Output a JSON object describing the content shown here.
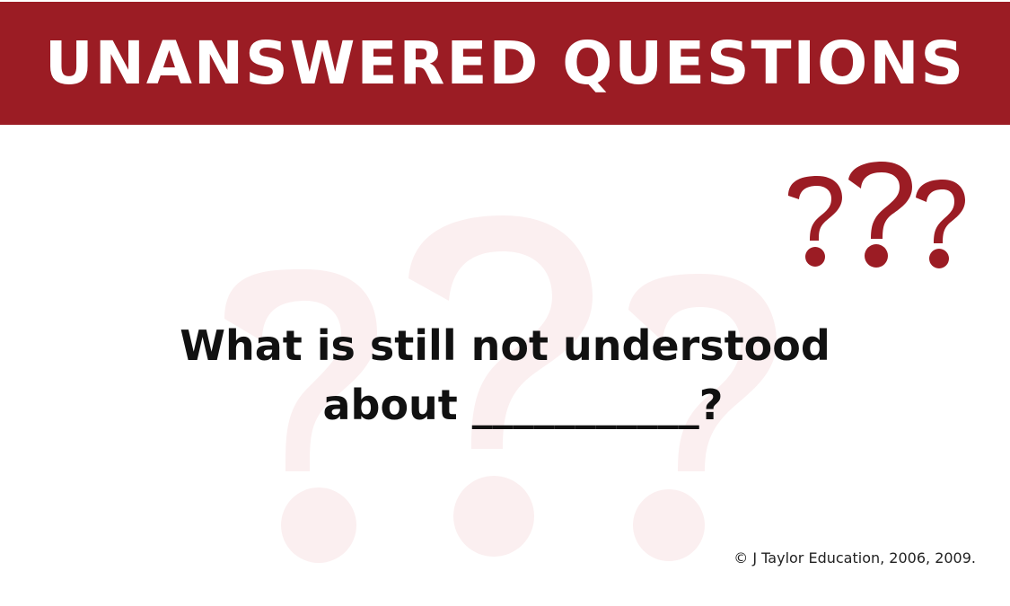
{
  "header": {
    "title": "UNANSWERED QUESTIONS"
  },
  "prompt": {
    "line1": "What is still not understood",
    "line2": "about ___________?"
  },
  "footer": {
    "copyright": "© J Taylor Education, 2006, 2009."
  },
  "colors": {
    "banner": "#9b1c24",
    "accent_question_marks": "#9b1c24",
    "watermark": "#fbeff0",
    "text": "#111111"
  },
  "icons": {
    "corner": "triple-question-marks-icon",
    "background": "question-marks-watermark-icon"
  }
}
